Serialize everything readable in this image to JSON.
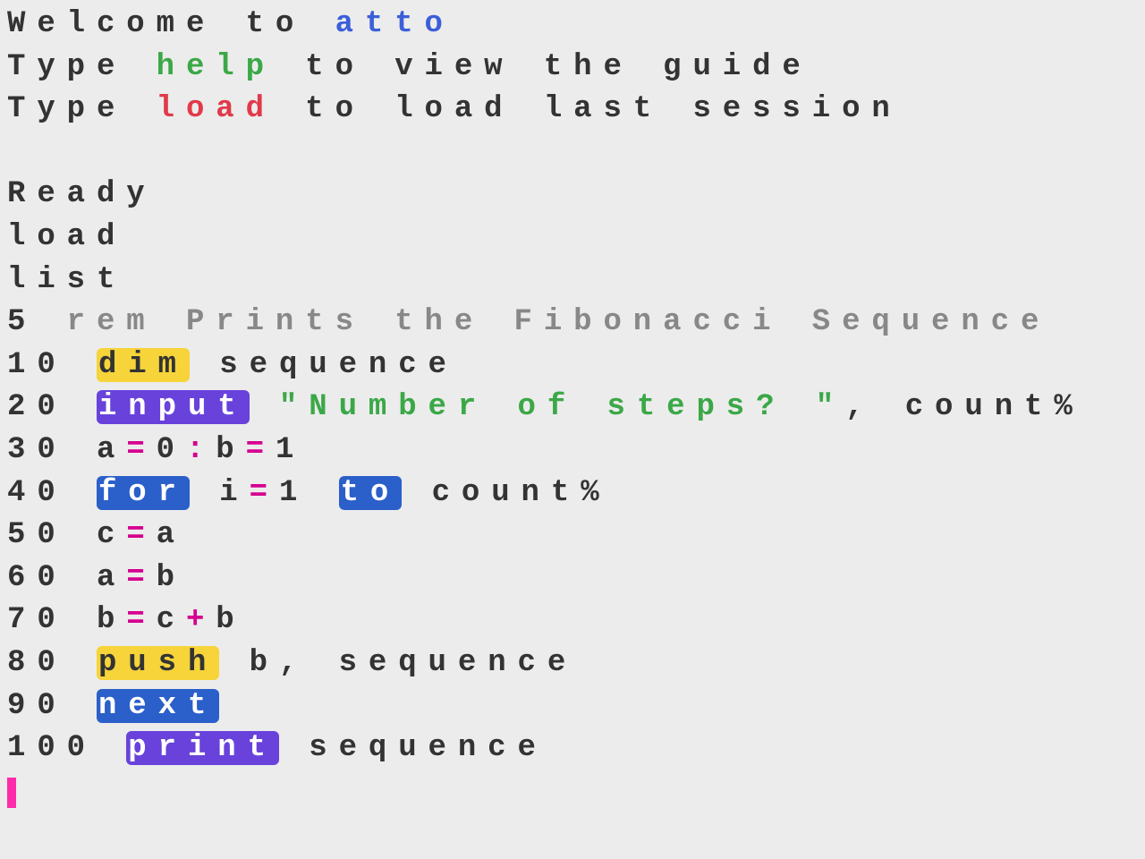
{
  "welcome": {
    "prefix": "Welcome to ",
    "app": "atto"
  },
  "help_line": {
    "prefix": "Type ",
    "cmd": "help",
    "suffix": " to view the guide"
  },
  "load_line": {
    "prefix": "Type ",
    "cmd": "load",
    "suffix": " to load last session"
  },
  "ready": "Ready",
  "cmd_load": "load",
  "cmd_list": "list",
  "program": {
    "l5": {
      "num": "5 ",
      "rem": "rem Prints the Fibonacci Sequence"
    },
    "l10": {
      "num": "10 ",
      "kw": "dim",
      "rest": " sequence"
    },
    "l20": {
      "num": "20 ",
      "kw": "input",
      "str": " \"Number of steps? \"",
      "rest": ", count%"
    },
    "l30": {
      "num": "30 ",
      "eq1": "a",
      "op1": "=",
      "v1": "0",
      "colon": ":",
      "eq2": "b",
      "op2": "=",
      "v2": "1"
    },
    "l40": {
      "num": "40 ",
      "kw1": "for",
      "mid": " i",
      "op": "=",
      "v": "1 ",
      "kw2": "to",
      "rest": " count%"
    },
    "l50": {
      "num": "50 ",
      "a": "c",
      "op": "=",
      "b": "a"
    },
    "l60": {
      "num": "60 ",
      "a": "a",
      "op": "=",
      "b": "b"
    },
    "l70": {
      "num": "70 ",
      "a": "b",
      "op1": "=",
      "b": "c",
      "op2": "+",
      "c": "b"
    },
    "l80": {
      "num": "80 ",
      "kw": "push",
      "rest": " b, sequence"
    },
    "l90": {
      "num": "90 ",
      "kw": "next"
    },
    "l100": {
      "num": "100 ",
      "kw": "print",
      "rest": " sequence"
    }
  }
}
